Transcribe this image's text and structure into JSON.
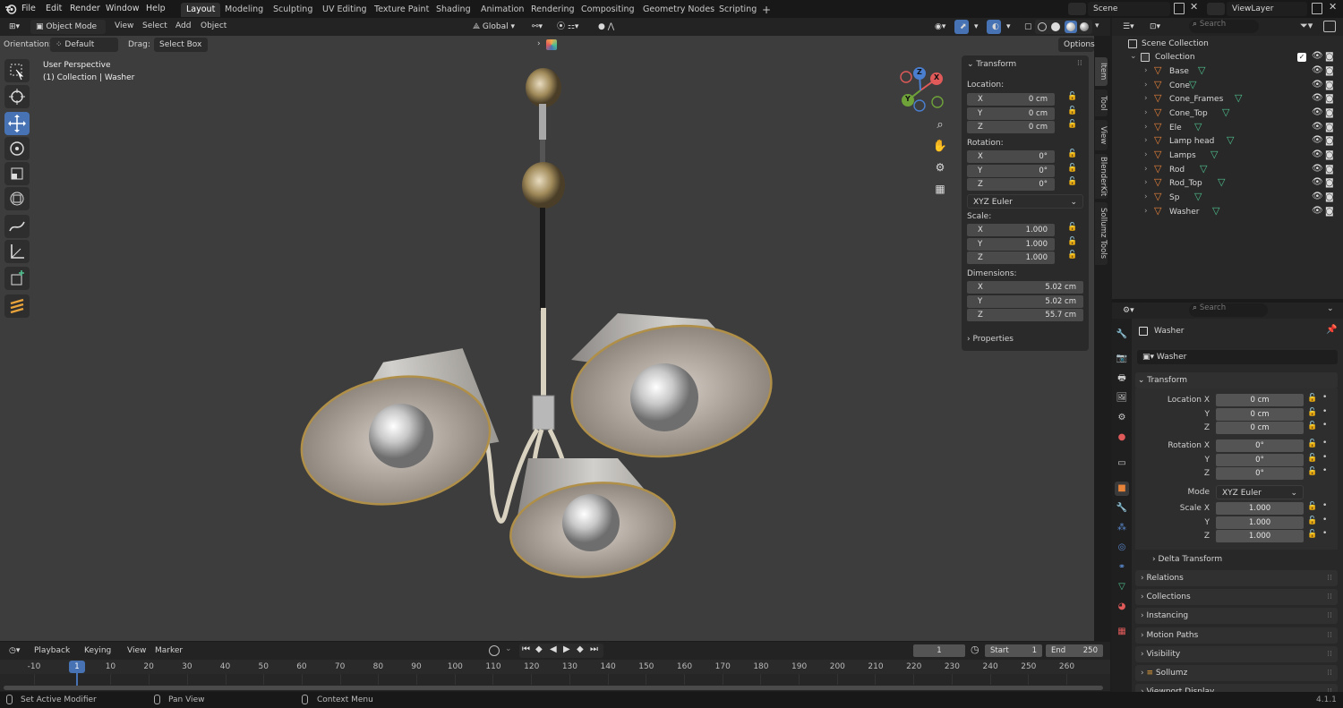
{
  "topbar": {
    "menus": [
      "File",
      "Edit",
      "Render",
      "Window",
      "Help"
    ],
    "workspaces": [
      "Layout",
      "Modeling",
      "Sculpting",
      "UV Editing",
      "Texture Paint",
      "Shading",
      "Animation",
      "Rendering",
      "Compositing",
      "Geometry Nodes",
      "Scripting"
    ],
    "active_workspace": "Layout",
    "add_tab": "+",
    "scene": "Scene",
    "view_layer": "ViewLayer"
  },
  "viewport_header": {
    "mode": "Object Mode",
    "menus": [
      "View",
      "Select",
      "Add",
      "Object"
    ],
    "transform_orientation": "Global",
    "options": "Options"
  },
  "tool_header": {
    "orientation_label": "Orientation:",
    "orientation_value": "Default",
    "drag_label": "Drag:",
    "drag_value": "Select Box"
  },
  "viewport": {
    "perspective": "User Perspective",
    "context": "(1) Collection | Washer",
    "gizmo": {
      "x": "X",
      "y": "Y",
      "z": "Z"
    }
  },
  "npanel": {
    "title": "Transform",
    "location_label": "Location:",
    "location": [
      {
        "axis": "X",
        "value": "0 cm"
      },
      {
        "axis": "Y",
        "value": "0 cm"
      },
      {
        "axis": "Z",
        "value": "0 cm"
      }
    ],
    "rotation_label": "Rotation:",
    "rotation": [
      {
        "axis": "X",
        "value": "0°"
      },
      {
        "axis": "Y",
        "value": "0°"
      },
      {
        "axis": "Z",
        "value": "0°"
      }
    ],
    "rotation_mode": "XYZ Euler",
    "scale_label": "Scale:",
    "scale": [
      {
        "axis": "X",
        "value": "1.000"
      },
      {
        "axis": "Y",
        "value": "1.000"
      },
      {
        "axis": "Z",
        "value": "1.000"
      }
    ],
    "dimensions_label": "Dimensions:",
    "dimensions": [
      {
        "axis": "X",
        "value": "5.02 cm"
      },
      {
        "axis": "Y",
        "value": "5.02 cm"
      },
      {
        "axis": "Z",
        "value": "55.7 cm"
      }
    ],
    "properties": "Properties",
    "tabs": [
      "Item",
      "Tool",
      "View",
      "BlenderKit",
      "Sollumz Tools"
    ]
  },
  "outliner": {
    "search_placeholder": "Search",
    "scene_collection": "Scene Collection",
    "collection": "Collection",
    "objects": [
      "Base",
      "Cone",
      "Cone_Frames",
      "Cone_Top",
      "Ele",
      "Lamp head",
      "Lamps",
      "Rod",
      "Rod_Top",
      "Sp",
      "Washer"
    ]
  },
  "properties": {
    "search_placeholder": "Search",
    "object_name": "Washer",
    "object_field": "Washer",
    "transform_title": "Transform",
    "location": [
      {
        "label": "Location X",
        "value": "0 cm"
      },
      {
        "label": "Y",
        "value": "0 cm"
      },
      {
        "label": "Z",
        "value": "0 cm"
      }
    ],
    "rotation": [
      {
        "label": "Rotation X",
        "value": "0°"
      },
      {
        "label": "Y",
        "value": "0°"
      },
      {
        "label": "Z",
        "value": "0°"
      }
    ],
    "mode_label": "Mode",
    "mode_value": "XYZ Euler",
    "scale": [
      {
        "label": "Scale X",
        "value": "1.000"
      },
      {
        "label": "Y",
        "value": "1.000"
      },
      {
        "label": "Z",
        "value": "1.000"
      }
    ],
    "delta_transform": "Delta Transform",
    "sections": [
      "Relations",
      "Collections",
      "Instancing",
      "Motion Paths",
      "Visibility",
      "Sollumz",
      "Viewport Display"
    ]
  },
  "timeline": {
    "menus": [
      "Playback",
      "Keying",
      "View",
      "Marker"
    ],
    "current_frame": "1",
    "start_label": "Start",
    "start_value": "1",
    "end_label": "End",
    "end_value": "250",
    "ruler": [
      "-10",
      "1",
      "10",
      "20",
      "30",
      "40",
      "50",
      "60",
      "70",
      "80",
      "90",
      "100",
      "110",
      "120",
      "130",
      "140",
      "150",
      "160",
      "170",
      "180",
      "190",
      "200",
      "210",
      "220",
      "230",
      "240",
      "250",
      "260"
    ]
  },
  "statusbar": {
    "left": "Set Active Modifier",
    "middle": "Pan View",
    "right": "Context Menu",
    "version": "4.1.1"
  },
  "colors": {
    "accent": "#4772b3",
    "object_orange": "#e8833a",
    "mesh_green": "#4fc18f"
  }
}
